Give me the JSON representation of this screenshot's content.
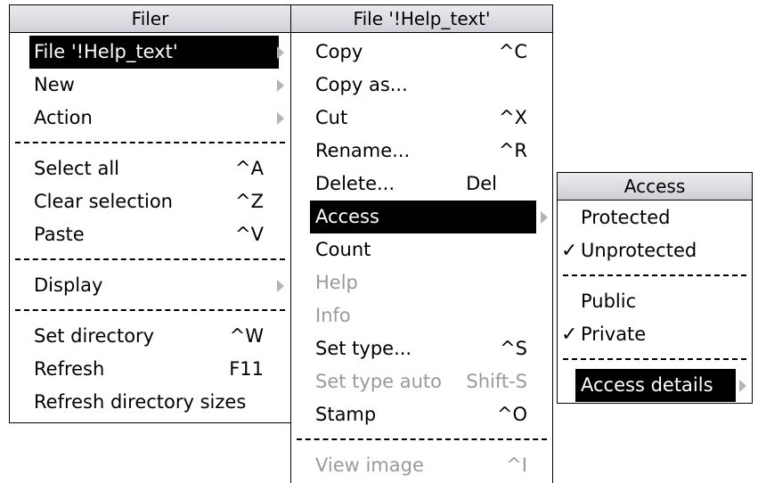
{
  "filer_menu": {
    "title": "Filer",
    "items": [
      {
        "label": "File '!Help_text'",
        "shortcut": ""
      },
      {
        "label": "New",
        "shortcut": ""
      },
      {
        "label": "Action",
        "shortcut": ""
      },
      {
        "label": "Select all",
        "shortcut": "^A"
      },
      {
        "label": "Clear selection",
        "shortcut": "^Z"
      },
      {
        "label": "Paste",
        "shortcut": "^V"
      },
      {
        "label": "Display",
        "shortcut": ""
      },
      {
        "label": "Set directory",
        "shortcut": "^W"
      },
      {
        "label": "Refresh",
        "shortcut": "F11"
      },
      {
        "label": "Refresh directory sizes",
        "shortcut": ""
      }
    ]
  },
  "file_menu": {
    "title": "File '!Help_text'",
    "items": [
      {
        "label": "Copy",
        "shortcut": "^C"
      },
      {
        "label": "Copy as...",
        "shortcut": ""
      },
      {
        "label": "Cut",
        "shortcut": "^X"
      },
      {
        "label": "Rename...",
        "shortcut": "^R"
      },
      {
        "label": "Delete...",
        "shortcut": "Del"
      },
      {
        "label": "Access",
        "shortcut": ""
      },
      {
        "label": "Count",
        "shortcut": ""
      },
      {
        "label": "Help",
        "shortcut": ""
      },
      {
        "label": "Info",
        "shortcut": ""
      },
      {
        "label": "Set type...",
        "shortcut": "^S"
      },
      {
        "label": "Set type auto",
        "shortcut": "Shift-S"
      },
      {
        "label": "Stamp",
        "shortcut": "^O"
      },
      {
        "label": "View image",
        "shortcut": "^I"
      }
    ]
  },
  "access_menu": {
    "title": "Access",
    "check_glyph": "✓",
    "items": [
      {
        "label": "Protected"
      },
      {
        "label": "Unprotected"
      },
      {
        "label": "Public"
      },
      {
        "label": "Private"
      },
      {
        "label": "Access details"
      }
    ]
  },
  "colors": {
    "highlight_bg": "#000000",
    "highlight_fg": "#ffffff",
    "disabled": "#9a9a9a",
    "title_bar": "#d8d8de",
    "submenu_arrow": "#b4b4b4"
  }
}
